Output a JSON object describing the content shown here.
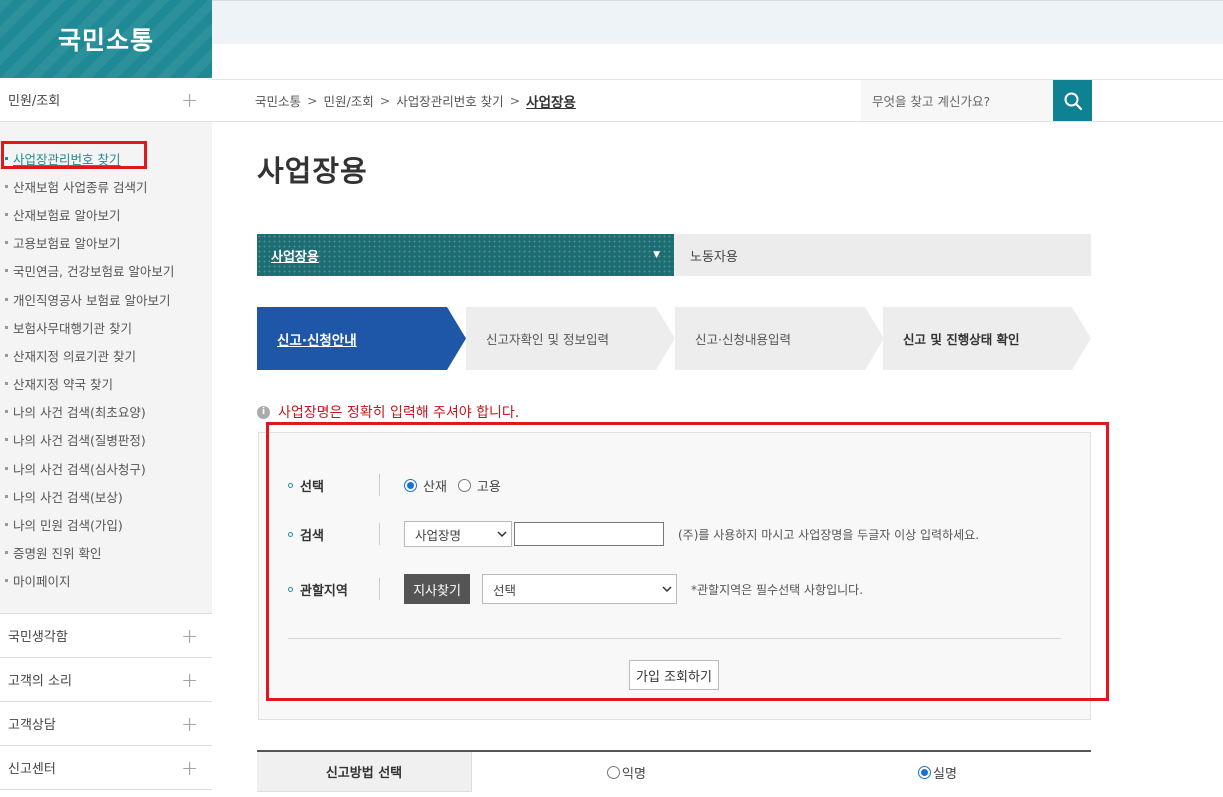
{
  "site": {
    "logo_text": "국민소통"
  },
  "sidebar": {
    "top_section": {
      "label": "민원/조회"
    },
    "items": [
      {
        "label": "사업장관리번호 찾기"
      },
      {
        "label": "산재보험 사업종류 검색기"
      },
      {
        "label": "산재보험료 알아보기"
      },
      {
        "label": "고용보험료 알아보기"
      },
      {
        "label": "국민연금, 건강보험료 알아보기"
      },
      {
        "label": "개인직영공사 보험료 알아보기"
      },
      {
        "label": "보험사무대행기관 찾기"
      },
      {
        "label": "산재지정 의료기관 찾기"
      },
      {
        "label": "산재지정 약국 찾기"
      },
      {
        "label": "나의 사건 검색(최초요양)"
      },
      {
        "label": "나의 사건 검색(질병판정)"
      },
      {
        "label": "나의 사건 검색(심사청구)"
      },
      {
        "label": "나의 사건 검색(보상)"
      },
      {
        "label": "나의 민원 검색(가입)"
      },
      {
        "label": "증명원 진위 확인"
      },
      {
        "label": "마이페이지"
      }
    ],
    "sections": [
      {
        "label": "국민생각함"
      },
      {
        "label": "고객의 소리"
      },
      {
        "label": "고객상담"
      },
      {
        "label": "신고센터"
      }
    ]
  },
  "breadcrumb": {
    "items": [
      "국민소통",
      "민원/조회",
      "사업장관리번호 찾기"
    ],
    "separator": ">",
    "current": "사업장용"
  },
  "search": {
    "placeholder": "무엇을 찾고 계신가요?"
  },
  "page_title": "사업장용",
  "tabs": [
    {
      "label": "사업장용",
      "active": true
    },
    {
      "label": "노동자용",
      "active": false
    }
  ],
  "steps": [
    {
      "label": "신고·신청안내",
      "active": true
    },
    {
      "label": "신고자확인 및 정보입력",
      "active": false
    },
    {
      "label": "신고·신청내용입력",
      "active": false
    },
    {
      "label": "신고 및 진행상태 확인",
      "active": false
    }
  ],
  "notice": "사업장명은 정확히 입력해 주셔야 합니다.",
  "form": {
    "select_type": {
      "label": "선택",
      "options": [
        "산재",
        "고용"
      ],
      "selected": "산재"
    },
    "search_row": {
      "label": "검색",
      "dropdown_value": "사업장명",
      "input_value": "",
      "hint": "(주)를 사용하지 마시고 사업장명을 두글자 이상 입력하세요."
    },
    "region_row": {
      "label": "관할지역",
      "button": "지사찾기",
      "dropdown_value": "선택",
      "hint": "*관할지역은 필수선택 사항입니다."
    },
    "submit": "가입 조회하기"
  },
  "report_method": {
    "header": "신고방법 선택",
    "options": [
      "익명",
      "실명"
    ],
    "selected": "실명"
  },
  "colors": {
    "brand": "#1f8a95",
    "step_active": "#1e56a8",
    "highlight": "#e0181b",
    "notice": "#c4181c"
  }
}
